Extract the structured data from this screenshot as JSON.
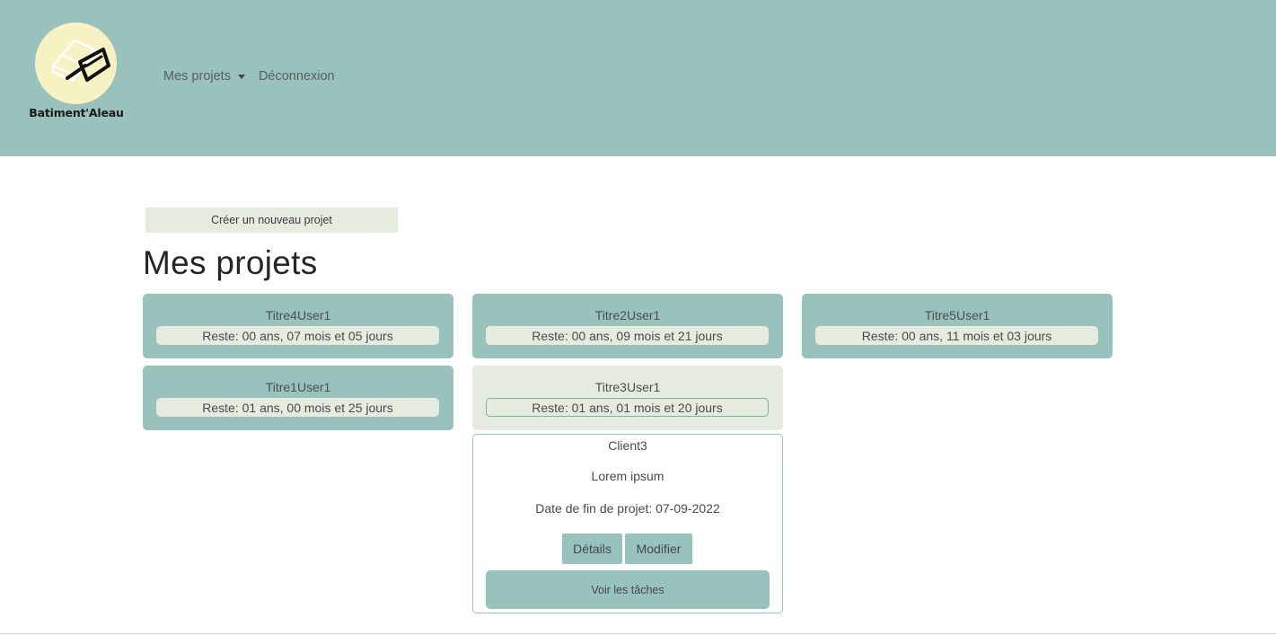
{
  "brand": {
    "name": "Batiment'Aleau",
    "logo_icon": "trowel-brick-icon",
    "logo_bg": "#f7f2c4"
  },
  "nav": {
    "projects_label": "Mes projets",
    "logout_label": "Déconnexion"
  },
  "main": {
    "create_button_label": "Créer un nouveau projet",
    "title": "Mes projets"
  },
  "projects": [
    {
      "title": "Titre4User1",
      "remaining": "Reste: 00 ans, 07 mois et 05 jours"
    },
    {
      "title": "Titre2User1",
      "remaining": "Reste: 00 ans, 09 mois et 21 jours"
    },
    {
      "title": "Titre5User1",
      "remaining": "Reste: 00 ans, 11 mois et 03 jours"
    },
    {
      "title": "Titre1User1",
      "remaining": "Reste: 01 ans, 00 mois et 25 jours"
    },
    {
      "title": "Titre3User1",
      "remaining": "Reste: 01 ans, 01 mois et 20 jours"
    }
  ],
  "selected_project": {
    "client": "Client3",
    "description": "Lorem ipsum",
    "end_date": "Date de fin de projet: 07-09-2022",
    "details_label": "Détails",
    "modify_label": "Modifier",
    "tasks_label": "Voir les tâches"
  },
  "colors": {
    "accent": "#9ac2bd",
    "light": "#e6ebe0"
  }
}
